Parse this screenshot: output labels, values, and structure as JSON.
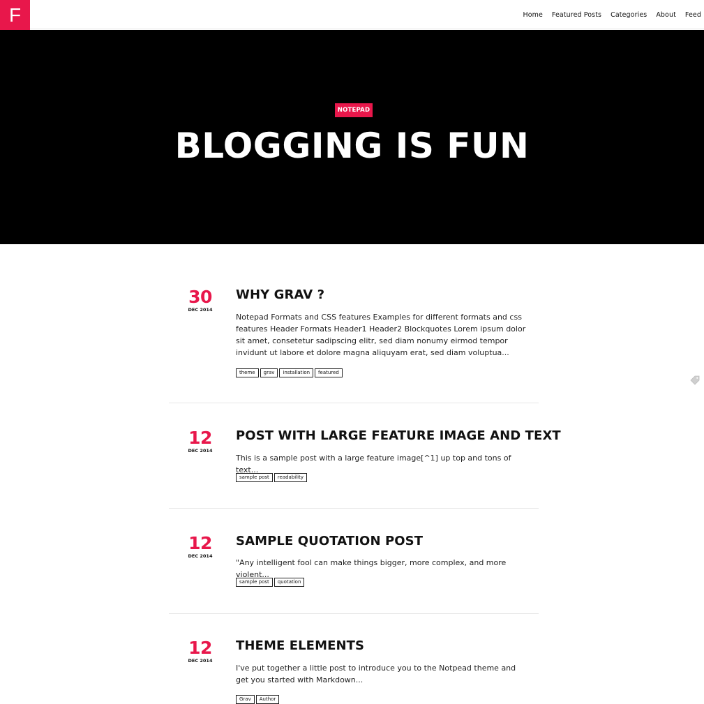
{
  "logo": {
    "letter": "F"
  },
  "nav": [
    "Home",
    "Featured Posts",
    "Categories",
    "About",
    "Feed"
  ],
  "hero": {
    "badge": "NOTEPAD",
    "title": "BLOGGING IS FUN"
  },
  "posts": [
    {
      "day": "30",
      "month": "DEC 2014",
      "title": "WHY GRAV ?",
      "excerpt": "Notepad Formats and CSS features Examples for different formats and css features Header Formats Header1 Header2 Blockquotes Lorem ipsum dolor sit amet, consetetur sadipscing elitr, sed diam nonumy eirmod tempor invidunt ut labore et dolore magna aliquyam erat, sed diam voluptua...",
      "tags": [
        "theme",
        "grav",
        "installation",
        "featured"
      ]
    },
    {
      "day": "12",
      "month": "DEC 2014",
      "title": "POST WITH LARGE FEATURE IMAGE AND TEXT",
      "excerpt": "This is a sample post with a large feature image[^1] up top and tons of text...",
      "tags": [
        "sample post",
        "readability"
      ]
    },
    {
      "day": "12",
      "month": "DEC 2014",
      "title": "SAMPLE QUOTATION POST",
      "excerpt": "\"Any intelligent fool can make things bigger, more complex, and more violent...",
      "tags": [
        "sample post",
        "quotation"
      ]
    },
    {
      "day": "12",
      "month": "DEC 2014",
      "title": "THEME ELEMENTS",
      "excerpt": "I've put together a little post to introduce you to the Notpead theme and get you started with Markdown...",
      "tags": [
        "Grav",
        "Author"
      ]
    }
  ],
  "colors": {
    "accent": "#e8174b",
    "hero_bg": "#000000"
  },
  "icons": {
    "side": "tag-icon"
  }
}
